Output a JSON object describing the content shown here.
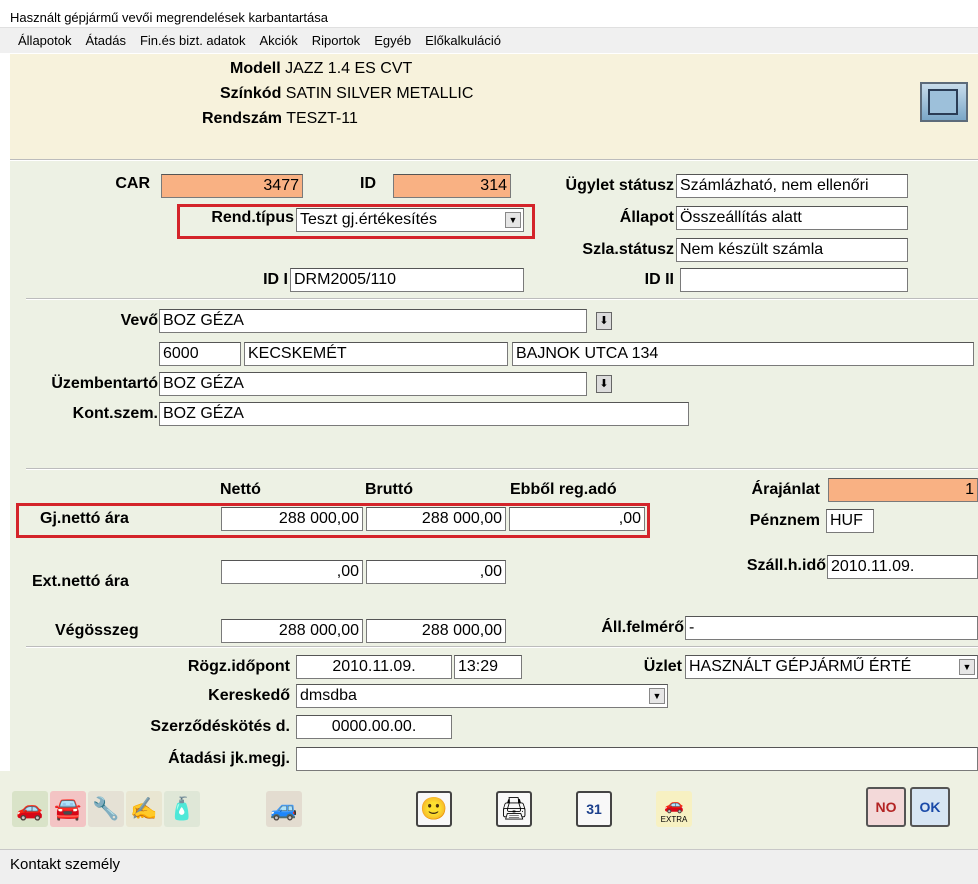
{
  "window": {
    "title": "Használt gépjármű vevői megrendelések karbantartása"
  },
  "menu": [
    "Állapotok",
    "Átadás",
    "Fin.és bizt. adatok",
    "Akciók",
    "Riportok",
    "Egyéb",
    "Előkalkuláció"
  ],
  "header": {
    "modell_label": "Modell",
    "modell_value": "JAZZ 1.4 ES CVT",
    "szinkod_label": "Színkód",
    "szinkod_value": "SATIN SILVER METALLIC",
    "rendszam_label": "Rendszám",
    "rendszam_value": "TESZT-11"
  },
  "top": {
    "car_label": "CAR",
    "car_value": "3477",
    "id_label": "ID",
    "id_value": "314",
    "ugylet_label": "Ügylet státusz",
    "ugylet_value": "Számlázható, nem ellenőri",
    "rendtipus_label": "Rend.típus",
    "rendtipus_value": "Teszt gj.értékesítés",
    "allapot_label": "Állapot",
    "allapot_value": "Összeállítás alatt",
    "szla_label": "Szla.státusz",
    "szla_value": "Nem készült számla",
    "id1_label": "ID I",
    "id1_value": "DRM2005/110",
    "id2_label": "ID II",
    "id2_value": ""
  },
  "customer": {
    "vevo_label": "Vevő",
    "vevo_value": "BOZ GÉZA",
    "zip": "6000",
    "city": "KECSKEMÉT",
    "street": "BAJNOK UTCA 134",
    "uzem_label": "Üzembentartó",
    "uzem_value": "BOZ GÉZA",
    "kont_label": "Kont.szem.",
    "kont_value": "BOZ GÉZA"
  },
  "prices": {
    "netto_header": "Nettó",
    "brutto_header": "Bruttó",
    "ebbol_header": "Ebből reg.adó",
    "gj_label": "Gj.nettó ára",
    "gj_netto": "288 000,00",
    "gj_brutto": "288 000,00",
    "gj_ebbol": ",00",
    "ext_label": "Ext.nettó ára",
    "ext_netto": ",00",
    "ext_brutto": ",00",
    "veg_label": "Végösszeg",
    "veg_netto": "288 000,00",
    "veg_brutto": "288 000,00",
    "arajanlat_label": "Árajánlat",
    "arajanlat_value": "1",
    "penznem_label": "Pénznem",
    "penznem_value": "HUF",
    "szall_label": "Száll.h.idő",
    "szall_value": "2010.11.09.",
    "allfel_label": "Áll.felmérő",
    "allfel_value": "-"
  },
  "bottom": {
    "rogz_label": "Rögz.időpont",
    "rogz_date": "2010.11.09.",
    "rogz_time": "13:29",
    "uzlet_label": "Üzlet",
    "uzlet_value": "HASZNÁLT GÉPJÁRMŰ ÉRTÉ",
    "keresk_label": "Kereskedő",
    "keresk_value": "dmsdba",
    "szerz_label": "Szerződéskötés d.",
    "szerz_value": "0000.00.00.",
    "atadas_label": "Átadási jk.megj.",
    "atadas_value": ""
  },
  "toolbar": {
    "extra_label": "EXTRA",
    "no_label": "NO",
    "ok_label": "OK",
    "calendar_label": "31"
  },
  "status": {
    "text": "Kontakt személy"
  },
  "colors": {
    "orange_field": "#f9b183",
    "highlight_box": "#d4242a",
    "form_bg": "#edf1e4",
    "header_bg": "#f7f2dc"
  }
}
